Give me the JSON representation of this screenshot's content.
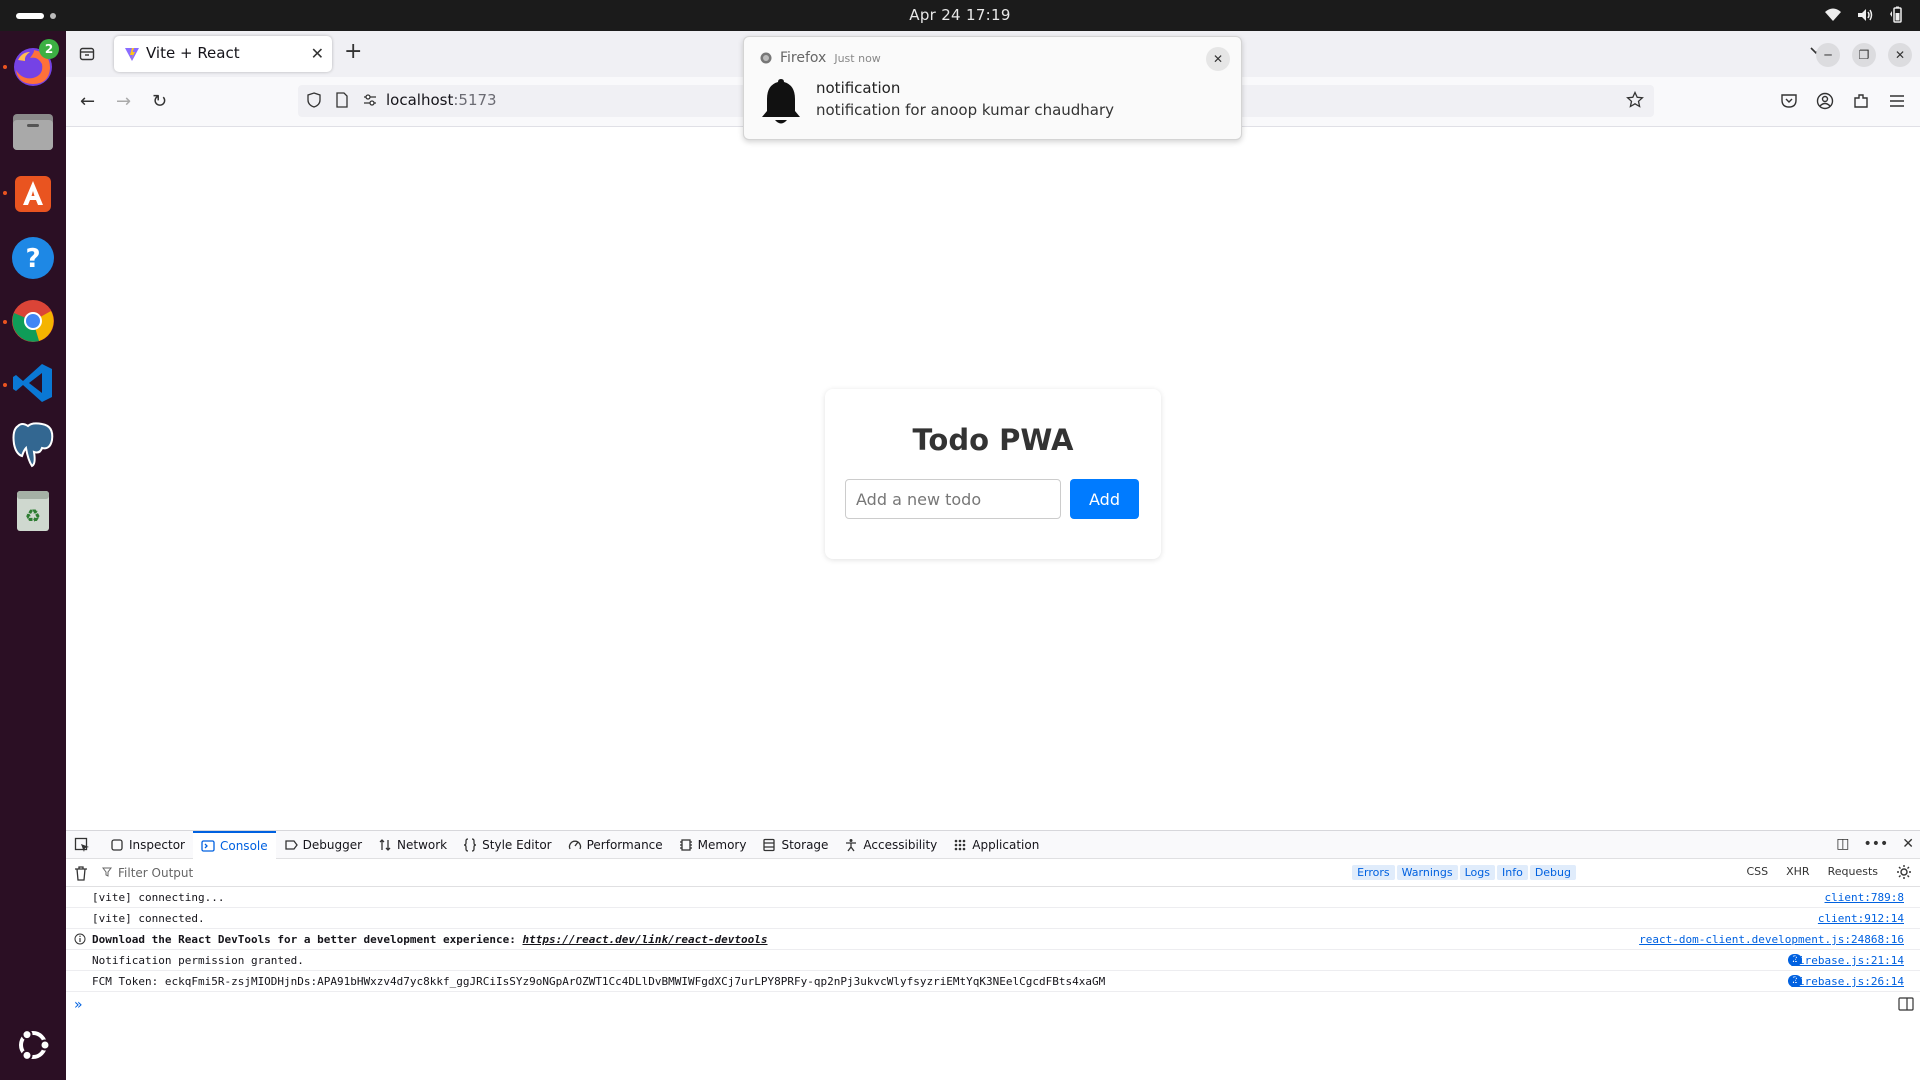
{
  "topbar": {
    "datetime": "Apr 24  17:19"
  },
  "dock": {
    "firefox_badge": "2"
  },
  "tab": {
    "title": "Vite + React"
  },
  "address": {
    "host": "localhost",
    "port": ":5173"
  },
  "notification": {
    "app": "Firefox",
    "time": "Just now",
    "title": "notification",
    "body": "notification for anoop kumar chaudhary"
  },
  "page": {
    "title": "Todo PWA",
    "input_placeholder": "Add a new todo",
    "add_label": "Add"
  },
  "devtools": {
    "tabs": [
      "Inspector",
      "Console",
      "Debugger",
      "Network",
      "Style Editor",
      "Performance",
      "Memory",
      "Storage",
      "Accessibility",
      "Application"
    ],
    "active_tab": "Console",
    "filter_placeholder": "Filter Output",
    "levels": [
      "Errors",
      "Warnings",
      "Logs",
      "Info",
      "Debug"
    ],
    "types": [
      "CSS",
      "XHR",
      "Requests"
    ],
    "logs": [
      {
        "message": "[vite] connecting...",
        "source": "client:789:8"
      },
      {
        "message": "[vite] connected.",
        "source": "client:912:14"
      },
      {
        "message": "Download the React DevTools for a better development experience: ",
        "link": "https://react.dev/link/react-devtools",
        "source": "react-dom-client.development.js:24868:16"
      },
      {
        "message": "Notification permission granted.",
        "count": "2",
        "source": "firebase.js:21:14"
      },
      {
        "message": "FCM Token: eckqFmi5R-zsjMIODHjnDs:APA91bHWxzv4d7yc8kkf_ggJRCiIsSYz9oNGpArOZWT1Cc4DLlDvBMWIWFgdXCj7urLPY8PRFy-qp2nPj3ukvcWlyfsyzriEMtYqK3NEelCgcdFBts4xaGM",
        "count": "2",
        "source": "firebase.js:26:14"
      }
    ]
  }
}
